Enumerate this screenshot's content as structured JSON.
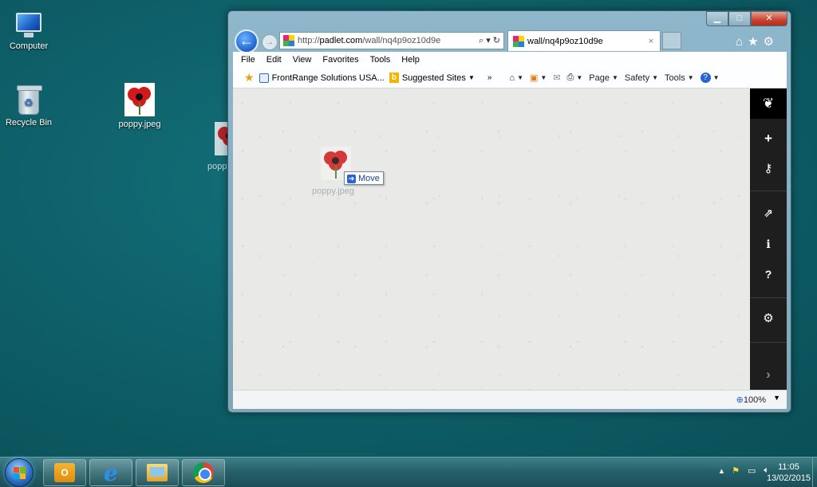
{
  "desktop": {
    "icons": [
      {
        "label": "Computer"
      },
      {
        "label": "Recycle Bin"
      },
      {
        "label": "poppy.jpeg"
      }
    ],
    "drag": {
      "ghost_label_1": "poppy.jp",
      "ghost_label_2": "poppy.jpeg",
      "move_label": "Move"
    }
  },
  "browser": {
    "address": {
      "prefix": "http://",
      "domain": "padlet.com",
      "path": "/wall/nq4p9oz10d9e",
      "tools": "⌕ ▾ ↻"
    },
    "tab": {
      "title": "wall/nq4p9oz10d9e",
      "close": "×"
    },
    "menu": [
      "File",
      "Edit",
      "View",
      "Favorites",
      "Tools",
      "Help"
    ],
    "favorites": {
      "item1": "FrontRange Solutions USA...",
      "item2": "Suggested Sites",
      "overflow": "»"
    },
    "commands": {
      "page": "Page",
      "safety": "Safety",
      "tools": "Tools"
    },
    "status": {
      "zoom": "100%"
    }
  },
  "taskbar": {
    "time": "11:05",
    "date": "13/02/2015"
  },
  "colors": {
    "desktop": "#0f5d66",
    "rail": "#1e1e1e",
    "accent": "#1f63d0"
  }
}
